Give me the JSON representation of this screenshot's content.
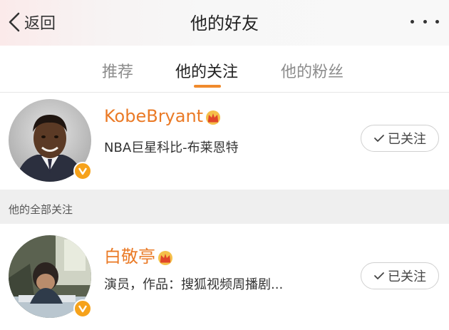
{
  "header": {
    "back_label": "返回",
    "title": "他的好友"
  },
  "tabs": [
    {
      "label": "推荐",
      "active": false
    },
    {
      "label": "他的关注",
      "active": true
    },
    {
      "label": "他的粉丝",
      "active": false
    }
  ],
  "colors": {
    "accent": "#f08a2c",
    "username": "#ea7a26",
    "verified_badge": "#f6a21b"
  },
  "featured_user": {
    "name": "KobeBryant",
    "description": "NBA巨星科比-布莱恩特",
    "follow_state": "已关注",
    "verified": true,
    "vip_icon": "crown-icon"
  },
  "section": {
    "label": "他的全部关注"
  },
  "follow_list": [
    {
      "name": "白敬亭",
      "description": "演员，作品：搜狐视频周播剧...",
      "follow_state": "已关注",
      "verified": true,
      "vip_icon": "crown-icon"
    }
  ]
}
